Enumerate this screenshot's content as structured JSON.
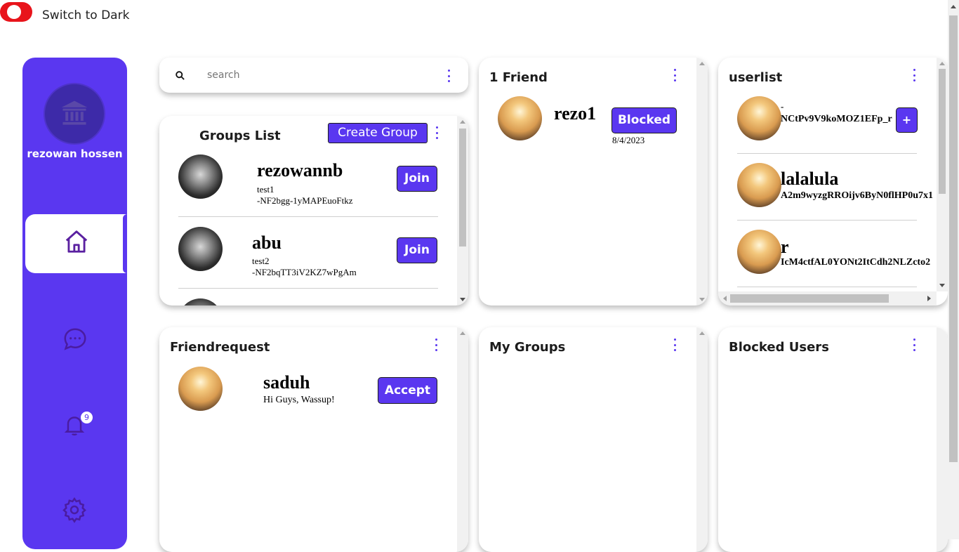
{
  "theme_toggle": {
    "label": "Switch to Dark"
  },
  "sidebar": {
    "username": "rezowan hossen",
    "notification_count": "9"
  },
  "search": {
    "placeholder": "search"
  },
  "groups_list": {
    "title": "Groups List",
    "create_label": "Create Group",
    "items": [
      {
        "name": "rezowannb",
        "subtitle": "test1",
        "id": "-NF2bgg-1yMAPEuoFtkz",
        "action": "Join"
      },
      {
        "name": "abu",
        "subtitle": "test2",
        "id": "-NF2bqTT3iV2KZ7wPgAm",
        "action": "Join"
      }
    ]
  },
  "friends": {
    "title": "1 Friend",
    "items": [
      {
        "name": "rezo1",
        "action": "Blocked",
        "date": "8/4/2023"
      }
    ]
  },
  "userlist": {
    "title": "userlist",
    "items": [
      {
        "name": "-",
        "id": "NCtPv9V9koMOZ1EFp_r",
        "action": "+"
      },
      {
        "name": "lalalula",
        "id": "A2m9wyzgRROijv6ByN0flHP0u7x1"
      },
      {
        "name": "r",
        "id": "IcM4ctfAL0YONt2ItCdh2NLZcto2"
      }
    ]
  },
  "friend_requests": {
    "title": "Friendrequest",
    "items": [
      {
        "name": "saduh",
        "message": "Hi Guys, Wassup!",
        "action": "Accept"
      }
    ]
  },
  "my_groups": {
    "title": "My Groups"
  },
  "blocked_users": {
    "title": "Blocked Users"
  },
  "colors": {
    "accent": "#5a37f0",
    "toggle": "#e8141b"
  }
}
